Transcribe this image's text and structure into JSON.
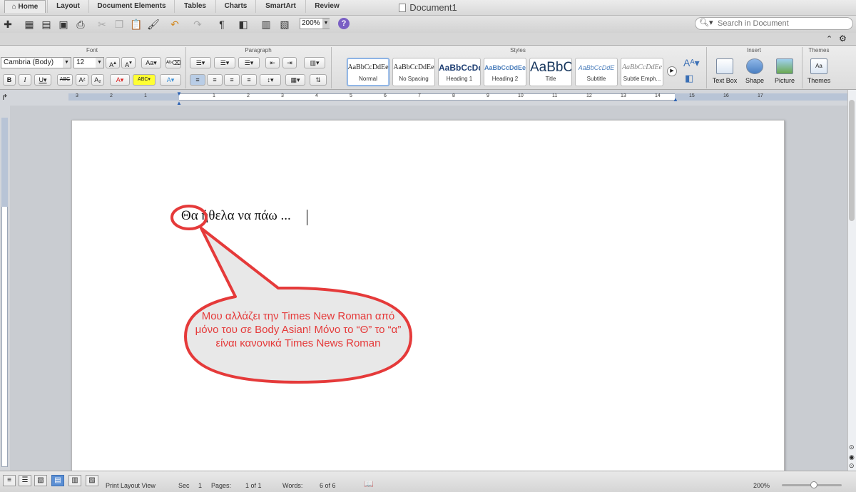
{
  "window": {
    "title": "Document1"
  },
  "toolbar": {
    "zoom": "200%",
    "search_placeholder": "Search in Document"
  },
  "tabs": [
    "Home",
    "Layout",
    "Document Elements",
    "Tables",
    "Charts",
    "SmartArt",
    "Review"
  ],
  "ribbon": {
    "groups": {
      "font": "Font",
      "paragraph": "Paragraph",
      "styles": "Styles",
      "insert": "Insert",
      "themes": "Themes"
    },
    "font_name": "Cambria (Body)",
    "font_size": "12",
    "styles": [
      {
        "sample": "AaBbCcDdEe",
        "name": "Normal"
      },
      {
        "sample": "AaBbCcDdEe",
        "name": "No Spacing"
      },
      {
        "sample": "AaBbCcDd",
        "name": "Heading 1"
      },
      {
        "sample": "AaBbCcDdEe",
        "name": "Heading 2"
      },
      {
        "sample": "AaBbC",
        "name": "Title"
      },
      {
        "sample": "AaBbCcDdE",
        "name": "Subtitle"
      },
      {
        "sample": "AaBbCcDdEe",
        "name": "Subtle Emph..."
      }
    ],
    "insert": {
      "text_box": "Text Box",
      "shape": "Shape",
      "picture": "Picture"
    },
    "themes": "Themes"
  },
  "ruler": {
    "numbers": [
      "3",
      "2",
      "1",
      "1",
      "2",
      "3",
      "4",
      "5",
      "6",
      "7",
      "8",
      "9",
      "10",
      "11",
      "12",
      "13",
      "14",
      "15",
      "16",
      "17"
    ]
  },
  "document": {
    "text": "Θα ήθελα να πάω ..."
  },
  "callout": {
    "text": "Μου αλλάζει την Times New Roman από μόνο του σε Body Asian! Μόνο το “Θ” το “α” είναι κανονικά Times News Roman",
    "color": "#e53a3a"
  },
  "status": {
    "view": "Print Layout View",
    "sec_label": "Sec",
    "sec_value": "1",
    "pages_label": "Pages:",
    "pages_value": "1 of 1",
    "words_label": "Words:",
    "words_value": "6 of 6",
    "zoom": "200%"
  }
}
